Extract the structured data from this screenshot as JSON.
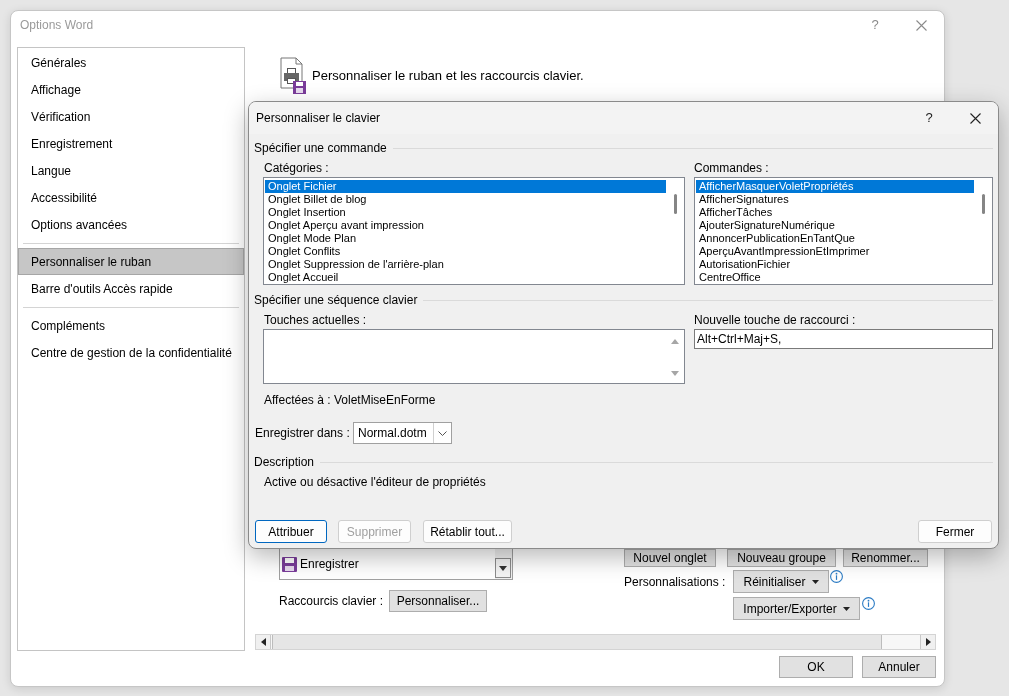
{
  "window": {
    "title": "Options Word",
    "help_button": "?"
  },
  "sidebar": {
    "groups": [
      {
        "items": [
          {
            "label": "Générales",
            "selected": false
          },
          {
            "label": "Affichage",
            "selected": false
          },
          {
            "label": "Vérification",
            "selected": false
          },
          {
            "label": "Enregistrement",
            "selected": false
          },
          {
            "label": "Langue",
            "selected": false
          },
          {
            "label": "Accessibilité",
            "selected": false
          },
          {
            "label": "Options avancées",
            "selected": false
          }
        ]
      },
      {
        "items": [
          {
            "label": "Personnaliser le ruban",
            "selected": true
          },
          {
            "label": "Barre d'outils Accès rapide",
            "selected": false
          }
        ]
      },
      {
        "items": [
          {
            "label": "Compléments",
            "selected": false
          },
          {
            "label": "Centre de gestion de la confidentialité",
            "selected": false
          }
        ]
      }
    ]
  },
  "main": {
    "heading": "Personnaliser le ruban et les raccourcis clavier.",
    "ribbon_list": {
      "items": [
        {
          "label": "Enregistrer"
        }
      ]
    },
    "ribbon_buttons": [
      {
        "label": "Nouvel onglet"
      },
      {
        "label": "Nouveau groupe"
      },
      {
        "label": "Renommer..."
      }
    ],
    "customizations": {
      "label": "Personnalisations :",
      "buttons": [
        {
          "label": "Réinitialiser"
        },
        {
          "label": "Importer/Exporter"
        }
      ]
    },
    "keyboard_shortcuts": {
      "label": "Raccourcis clavier :",
      "button": "Personnaliser..."
    }
  },
  "footer_buttons": [
    {
      "label": "OK"
    },
    {
      "label": "Annuler"
    }
  ],
  "dialog": {
    "title": "Personnaliser le clavier",
    "help_button": "?",
    "command_section": {
      "heading": "Spécifier une commande",
      "categories": {
        "label": "Catégories :",
        "items": [
          {
            "label": "Onglet Fichier",
            "selected": true
          },
          {
            "label": "Onglet Billet de blog",
            "selected": false
          },
          {
            "label": "Onglet Insertion",
            "selected": false
          },
          {
            "label": "Onglet Aperçu avant impression",
            "selected": false
          },
          {
            "label": "Onglet Mode Plan",
            "selected": false
          },
          {
            "label": "Onglet Conflits",
            "selected": false
          },
          {
            "label": "Onglet Suppression de l'arrière-plan",
            "selected": false
          },
          {
            "label": "Onglet Accueil",
            "selected": false
          }
        ]
      },
      "commands": {
        "label": "Commandes :",
        "items": [
          {
            "label": "AfficherMasquerVoletPropriétés",
            "selected": true
          },
          {
            "label": "AfficherSignatures",
            "selected": false
          },
          {
            "label": "AfficherTâches",
            "selected": false
          },
          {
            "label": "AjouterSignatureNumérique",
            "selected": false
          },
          {
            "label": "AnnoncerPublicationEnTantQue",
            "selected": false
          },
          {
            "label": "AperçuAvantImpressionEtImprimer",
            "selected": false
          },
          {
            "label": "AutorisationFichier",
            "selected": false
          },
          {
            "label": "CentreOffice",
            "selected": false
          }
        ]
      }
    },
    "key_section": {
      "heading": "Spécifier une séquence clavier",
      "current_keys": {
        "label": "Touches actuelles :"
      },
      "new_shortcut": {
        "label": "Nouvelle touche de raccourci :",
        "value": "Alt+Ctrl+Maj+S,"
      },
      "assigned_to": {
        "label": "Affectées à :",
        "value": "VoletMiseEnForme"
      }
    },
    "save_in": {
      "label": "Enregistrer dans :",
      "value": "Normal.dotm"
    },
    "description": {
      "heading": "Description",
      "text": "Active ou désactive l'éditeur de propriétés"
    },
    "buttons": [
      {
        "label": "Attribuer",
        "default": true,
        "disabled": false
      },
      {
        "label": "Supprimer",
        "default": false,
        "disabled": true
      },
      {
        "label": "Rétablir tout...",
        "default": false,
        "disabled": false
      }
    ],
    "close_button": {
      "label": "Fermer"
    }
  }
}
